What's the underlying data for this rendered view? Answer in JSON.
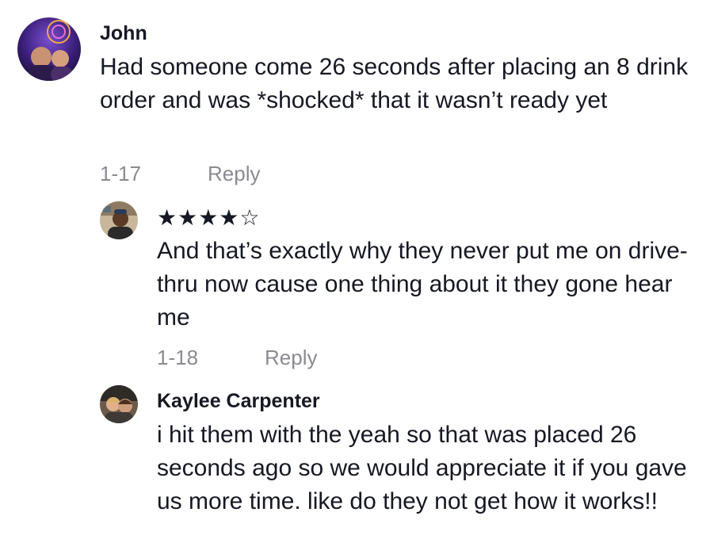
{
  "comments": [
    {
      "username": "John",
      "text": "Had someone come 26 seconds after placing an 8 drink order and was *shocked* that it wasn’t ready yet",
      "date": "1-17",
      "reply_label": "Reply"
    },
    {
      "username": "★★★★☆",
      "text": "And that’s exactly why they never put me on drive-thru now cause one thing about it they gone hear me",
      "date": "1-18",
      "reply_label": "Reply"
    },
    {
      "username": "Kaylee Carpenter",
      "text": "i hit them with the yeah so that was placed 26 seconds ago so we would appreciate it if you gave us more time. like do they not get how it works!!"
    }
  ],
  "colors": {
    "text": "#161823",
    "meta": "#8a8b91"
  }
}
